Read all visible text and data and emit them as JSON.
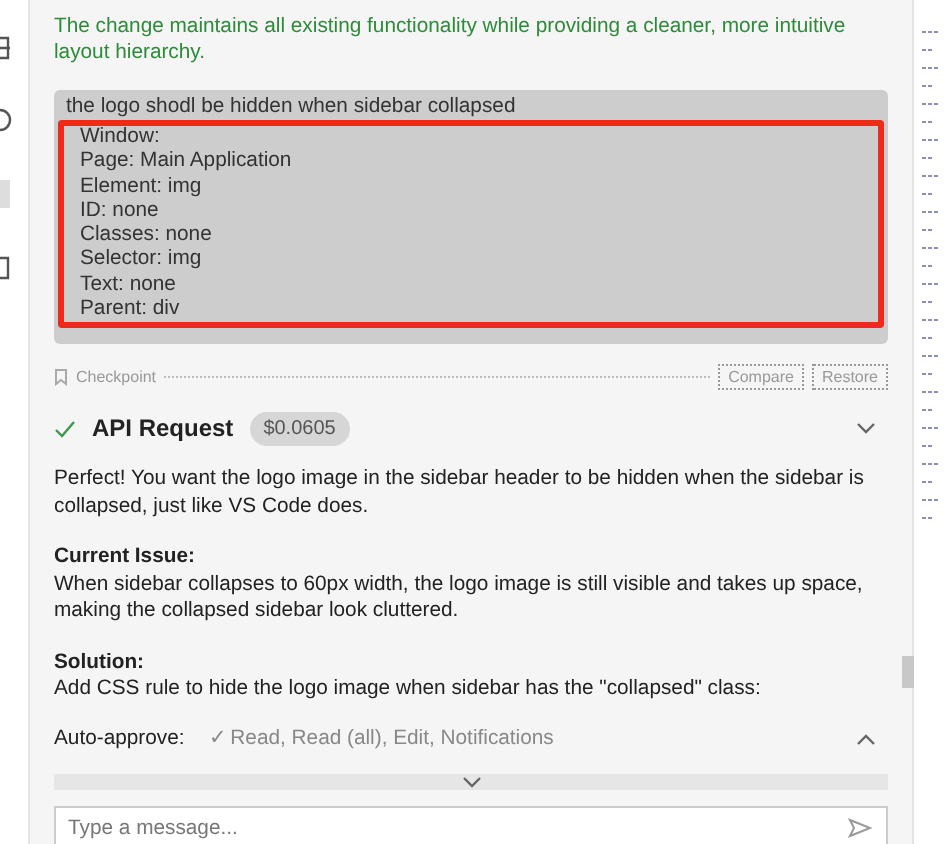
{
  "summary": "The change maintains all existing functionality while providing a cleaner, more intuitive layout hierarchy.",
  "user_message": {
    "text": "the logo shodl be hidden when sidebar collapsed",
    "highlight_lines": [
      "Window:",
      "Page: Main Application",
      "Element: img",
      "ID: none",
      "Classes: none",
      "Selector: img",
      "Text: none",
      "Parent: div"
    ]
  },
  "checkpoint": {
    "label": "Checkpoint",
    "buttons": [
      "Compare",
      "Restore"
    ]
  },
  "api_request": {
    "title": "API Request",
    "cost": "$0.0605",
    "done": true,
    "expanded": false
  },
  "response": [
    {
      "kind": "para",
      "text": "Perfect! You want the logo image in the sidebar header to be hidden when the sidebar is collapsed, just like VS Code does."
    },
    {
      "kind": "section",
      "heading": "Current Issue:",
      "text": "When sidebar collapses to 60px width, the logo image is still visible and takes up space, making the collapsed sidebar look cluttered."
    },
    {
      "kind": "section",
      "heading": "Solution:",
      "text": "Add CSS rule to hide the logo image when sidebar has the \"collapsed\" class:"
    }
  ],
  "auto_approve": {
    "label": "Auto-approve:",
    "value": "✓ Read, Read (all), Edit, Notifications",
    "expanded": false
  },
  "input": {
    "placeholder": "Type a message..."
  }
}
